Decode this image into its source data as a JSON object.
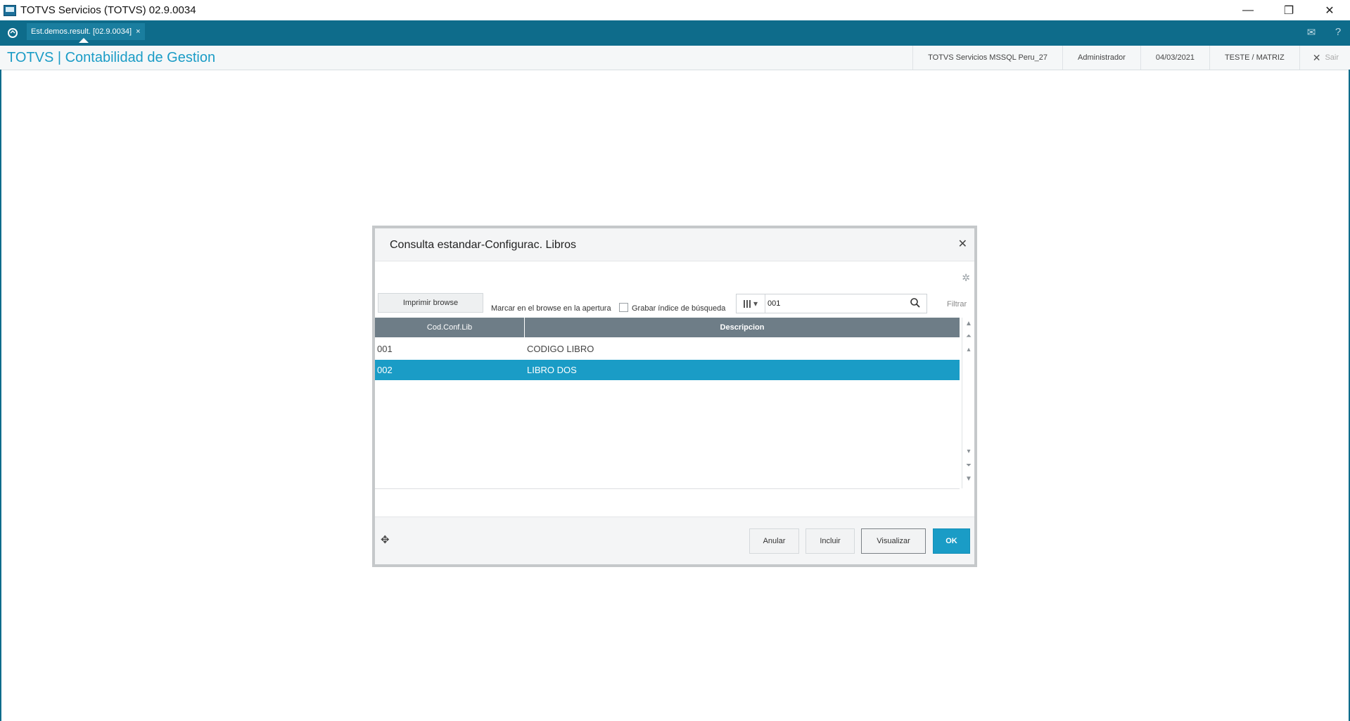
{
  "window": {
    "title": "TOTVS Servicios (TOTVS) 02.9.0034",
    "controls": {
      "minimize": "—",
      "restore": "❐",
      "close": "✕"
    }
  },
  "tabs": [
    {
      "label": "Est.demos.result. [02.9.0034]",
      "close": "×"
    }
  ],
  "module": {
    "title": "TOTVS | Contabilidad de Gestion",
    "environment": "TOTVS Servicios MSSQL Peru_27",
    "user": "Administrador",
    "date": "04/03/2021",
    "branch": "TESTE / MATRIZ",
    "exit_label": "Sair"
  },
  "dialog": {
    "title": "Consulta estandar-Configurac. Libros",
    "print_button": "Imprimir browse",
    "mark_label": "Marcar en el browse en la apertura",
    "save_index_label": "Grabar índice de búsqueda",
    "search": {
      "value": "001"
    },
    "filter_label": "Filtrar",
    "columns": [
      "Cod.Conf.Lib",
      "Descripcion"
    ],
    "rows": [
      {
        "code": "001",
        "description": "CODIGO LIBRO",
        "selected": false
      },
      {
        "code": "002",
        "description": "LIBRO DOS",
        "selected": true
      }
    ],
    "buttons": {
      "cancel": "Anular",
      "include": "Incluir",
      "view": "Visualizar",
      "ok": "OK"
    }
  },
  "colors": {
    "tabstrip": "#0e6c8b",
    "accent": "#1a9cc6",
    "grid_header": "#6e7d87"
  }
}
